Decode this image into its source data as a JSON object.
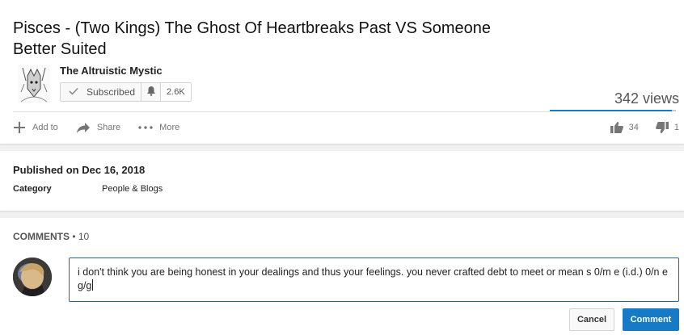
{
  "video": {
    "title": "Pisces - (Two Kings) The Ghost Of Heartbreaks Past VS Someone Better Suited",
    "views": "342 views",
    "like_ratio": 0.971
  },
  "channel": {
    "name": "The Altruistic Mystic",
    "subscribe_label": "Subscribed",
    "subscriber_count": "2.6K"
  },
  "actions": {
    "add_to": "Add to",
    "share": "Share",
    "more": "More"
  },
  "likes": {
    "like_count": "34",
    "dislike_count": "1"
  },
  "meta": {
    "published": "Published on Dec 16, 2018",
    "category_label": "Category",
    "category_value": "People & Blogs"
  },
  "comments": {
    "label": "COMMENTS",
    "separator": " • ",
    "count": "10",
    "draft": "i don't think you are being honest in your dealings and thus your feelings. you never crafted debt to meet or mean s 0/m e (i.d.) 0/n e g/g",
    "cancel_label": "Cancel",
    "submit_label": "Comment"
  },
  "colors": {
    "accent": "#167ac6",
    "focus_border": "#1c62b9",
    "page_bg": "#f1f1f1"
  },
  "icons": [
    "check-icon",
    "bell-icon",
    "plus-icon",
    "share-arrow-icon",
    "more-dots-icon",
    "thumbs-up-icon",
    "thumbs-down-icon"
  ]
}
